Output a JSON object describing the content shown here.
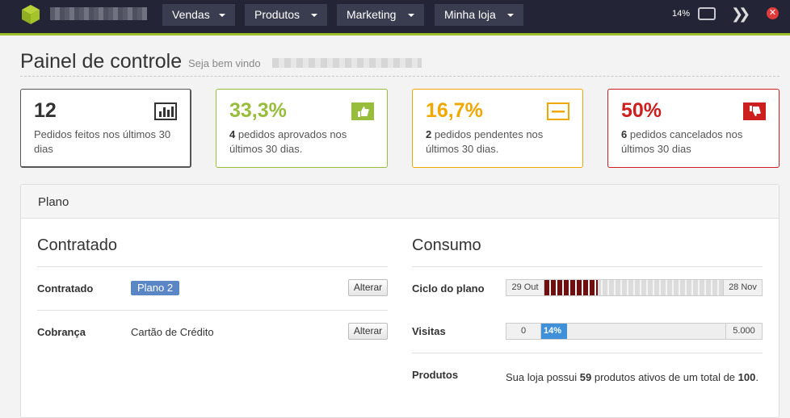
{
  "topbar": {
    "menus": [
      {
        "label": "Vendas"
      },
      {
        "label": "Produtos"
      },
      {
        "label": "Marketing"
      },
      {
        "label": "Minha loja"
      }
    ],
    "progress_label": "14%",
    "close_label": "✕",
    "forward_label": "❯❯"
  },
  "header": {
    "title": "Painel de controle",
    "welcome": "Seja bem vindo"
  },
  "stats": [
    {
      "value": "12",
      "count": "",
      "text": "Pedidos feitos nos últimos 30 dias",
      "color": "#333333",
      "icon": "bar-chart-icon"
    },
    {
      "value": "33,3%",
      "count": "4",
      "text": " pedidos aprovados nos últimos 30 dias.",
      "color": "#97bd3b",
      "icon": "thumbs-up-icon"
    },
    {
      "value": "16,7%",
      "count": "2",
      "text": " pedidos pendentes nos últimos 30 dias.",
      "color": "#f0a800",
      "icon": "minus-box-icon"
    },
    {
      "value": "50%",
      "count": "6",
      "text": " pedidos cancelados nos últimos 30 dias",
      "color": "#cc1f1f",
      "icon": "thumbs-down-icon"
    }
  ],
  "plano": {
    "title": "Plano",
    "contratado": {
      "section_title": "Contratado",
      "rows": [
        {
          "label": "Contratado",
          "badge": "Plano 2",
          "button": "Alterar"
        },
        {
          "label": "Cobrança",
          "value": "Cartão de Crédito",
          "button": "Alterar"
        }
      ]
    },
    "consumo": {
      "section_title": "Consumo",
      "cycle": {
        "label": "Ciclo do plano",
        "start": "29 Out",
        "end": "28 Nov",
        "progress": 0.3
      },
      "visits": {
        "label": "Visitas",
        "min": "0",
        "max": "5.000",
        "percent_label": "14%",
        "progress": 0.14
      },
      "products": {
        "label": "Produtos",
        "prefix": "Sua loja possui ",
        "active": "59",
        "middle": " produtos ativos de um total de ",
        "total": "100",
        "suffix": "."
      }
    }
  }
}
